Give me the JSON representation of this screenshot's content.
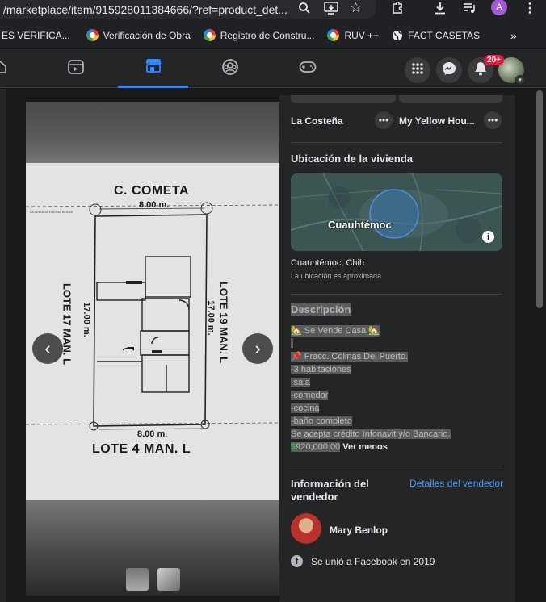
{
  "browser": {
    "url": "/marketplace/item/915928011384666/?ref=product_det...",
    "bookmarks": [
      "ES VERIFICA...",
      "Verificación de Obra",
      "Registro de Constru...",
      "RUV ++",
      "FACT CASETAS"
    ],
    "profile_initial": "A"
  },
  "nav": {
    "notifications_badge": "20+"
  },
  "related": {
    "item1": "La Costeña",
    "item2": "My Yellow Hou..."
  },
  "location": {
    "heading": "Ubicación de la vivienda",
    "map_city": "Cuauhtémoc",
    "city": "Cuauhtémoc, Chih",
    "note": "La ubicación es aproximada"
  },
  "plan": {
    "street": "C. COMETA",
    "top_width": "8.00 m.",
    "bottom_width": "8.00 m.",
    "left_lot": "LOTE 17 MAN. L",
    "left_len": "17.00 m.",
    "right_lot": "LOTE 19 MAN. L",
    "right_len": "17.00 m.",
    "bottom_lot": "LOTE 4 MAN. L"
  },
  "description": {
    "heading": "Descripción",
    "lines": [
      "Se Vende Casa",
      "Fracc. Colinas Del Puerto.",
      "-3 habitaciones",
      "-sala",
      "-comedor",
      "-cocina",
      "-baño completo",
      "Se acepta crédito Infonavit y/o Bancario.",
      "920,000.00"
    ],
    "see_less": "Ver menos"
  },
  "seller": {
    "heading_line1": "Información del",
    "heading_line2": "vendedor",
    "details_link": "Detalles del vendedor",
    "name": "Mary Benlop",
    "joined": "Se unió a Facebook en 2019"
  },
  "colors": {
    "accent": "#2d88ff",
    "link": "#4599ff",
    "badge": "#e41e3f",
    "bg": "#18191a",
    "panel": "#242526"
  }
}
